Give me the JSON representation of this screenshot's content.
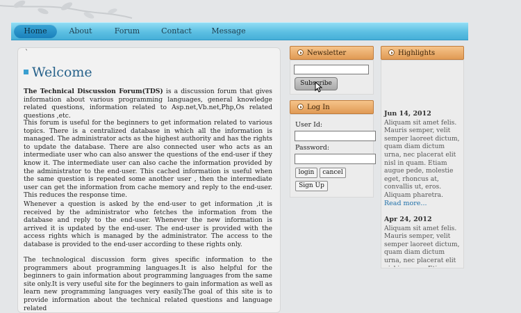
{
  "nav": {
    "items": [
      {
        "label": "Home",
        "active": true
      },
      {
        "label": "About",
        "active": false
      },
      {
        "label": "Forum",
        "active": false
      },
      {
        "label": "Contact",
        "active": false
      },
      {
        "label": "Message",
        "active": false
      }
    ]
  },
  "main": {
    "tick": "`",
    "title": "Welcome",
    "intro_bold": "The Technical Discussion Forum(TDS)",
    "intro_rest": " is a discussion forum that gives information about various programming languages, general knowledge related questions, information related to Asp.net,Vb.net,Php,Os related questions ,etc.",
    "para2": "This forum is useful for the beginners to get information related to various topics. There is a centralized database in which all the information is managed. The administrator acts as the highest authority and has the rights to update the database. There are also connected user who acts as an intermediate user who can also answer the questions of the end-user if they know it. The intermediate user can also cache the information provided by the administrator to the end-user. This cached information is useful when the same question is repeated some another user , then the intermediate user can get the information from cache memory and reply to the end-user. This reduces the response time.",
    "para3": "Whenever a question is asked by the end-user to get information ,it is received by the administrator who fetches the information from the database and reply to the end-user. Whenever the new information is arrived it is updated by the end-user. The end-user is provided with the access rights which is managed by the administrator. The access to the database is provided to the end-user according to these rights only.",
    "para4": "The technological discussion form gives specific information to the programmers about programming languages.It is also helpful for the beginners to gain information about programming languages from the same site only.It is very useful site for the beginners to gain information as well as learn new programming languages very easily.The goal of this site is to provide information about the technical related questions and language related"
  },
  "newsletter": {
    "header": "Newsletter",
    "email_value": "",
    "subscribe_label": "Subscribe"
  },
  "login": {
    "header": "Log In",
    "userid_label": "User Id:",
    "userid_value": "",
    "password_label": "Password:",
    "password_value": "",
    "login_label": "login",
    "cancel_label": "cancel",
    "signup_label": "Sign Up"
  },
  "highlights": {
    "header": "Highlights",
    "items": [
      {
        "date": "Jun 14, 2012",
        "text": "Aliquam sit amet felis. Mauris semper, velit semper laoreet dictum, quam diam dictum urna, nec placerat elit nisl in quam. Etiam augue pede, molestie eget, rhoncus at, convallis ut, eros. Aliquam pharetra.",
        "more": "Read more..."
      },
      {
        "date": "Apr 24, 2012",
        "text": "Aliquam sit amet felis. Mauris semper, velit semper laoreet dictum, quam diam dictum urna, nec placerat elit nisl in quam. Etiam",
        "more": ""
      }
    ]
  },
  "colors": {
    "nav": "#5cbfe2",
    "header_box": "#e09a54",
    "title": "#26618a",
    "link": "#1e6fa8"
  }
}
